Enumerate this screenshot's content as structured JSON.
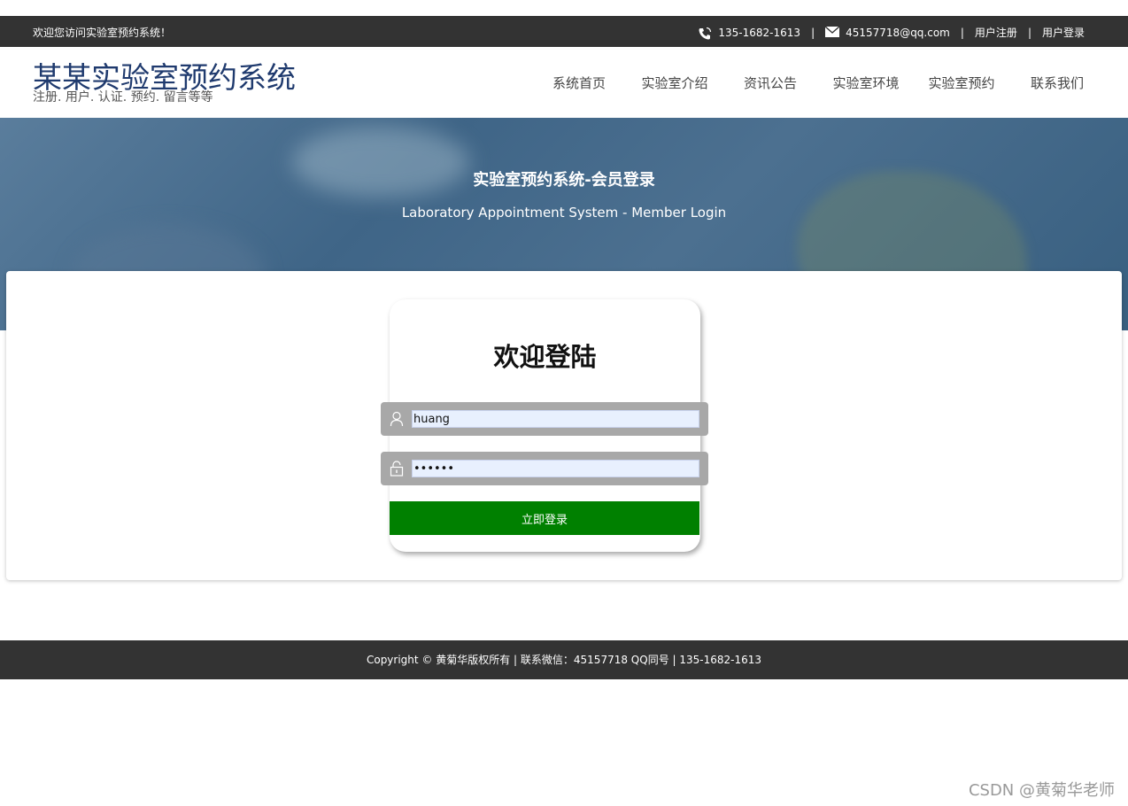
{
  "topbar": {
    "welcome": "欢迎您访问实验室预约系统！",
    "phone": "135-1682-1613",
    "email": "45157718@qq.com",
    "separator": "|",
    "register": "用户注册",
    "login": "用户登录",
    "phone_icon": "phone-icon",
    "email_icon": "mail-icon"
  },
  "header": {
    "logo_title": "某某实验室预约系统",
    "logo_subtitle": "注册. 用户. 认证. 预约. 留言等等"
  },
  "nav": {
    "items": [
      "系统首页",
      "实验室介绍",
      "资讯公告",
      "实验室环境",
      "实验室预约",
      "联系我们"
    ]
  },
  "banner": {
    "title": "实验室预约系统-会员登录",
    "subtitle": "Laboratory Appointment System - Member Login"
  },
  "login": {
    "heading": "欢迎登陆",
    "username_value": "huang",
    "password_value": "••••••",
    "submit_label": "立即登录",
    "button_color": "#008000",
    "user_icon": "user-icon",
    "lock_icon": "lock-icon"
  },
  "footer": {
    "text": "Copyright © 黄菊华版权所有 | 联系微信：45157718 QQ同号 | 135-1682-1613"
  },
  "watermark": "CSDN @黄菊华老师"
}
